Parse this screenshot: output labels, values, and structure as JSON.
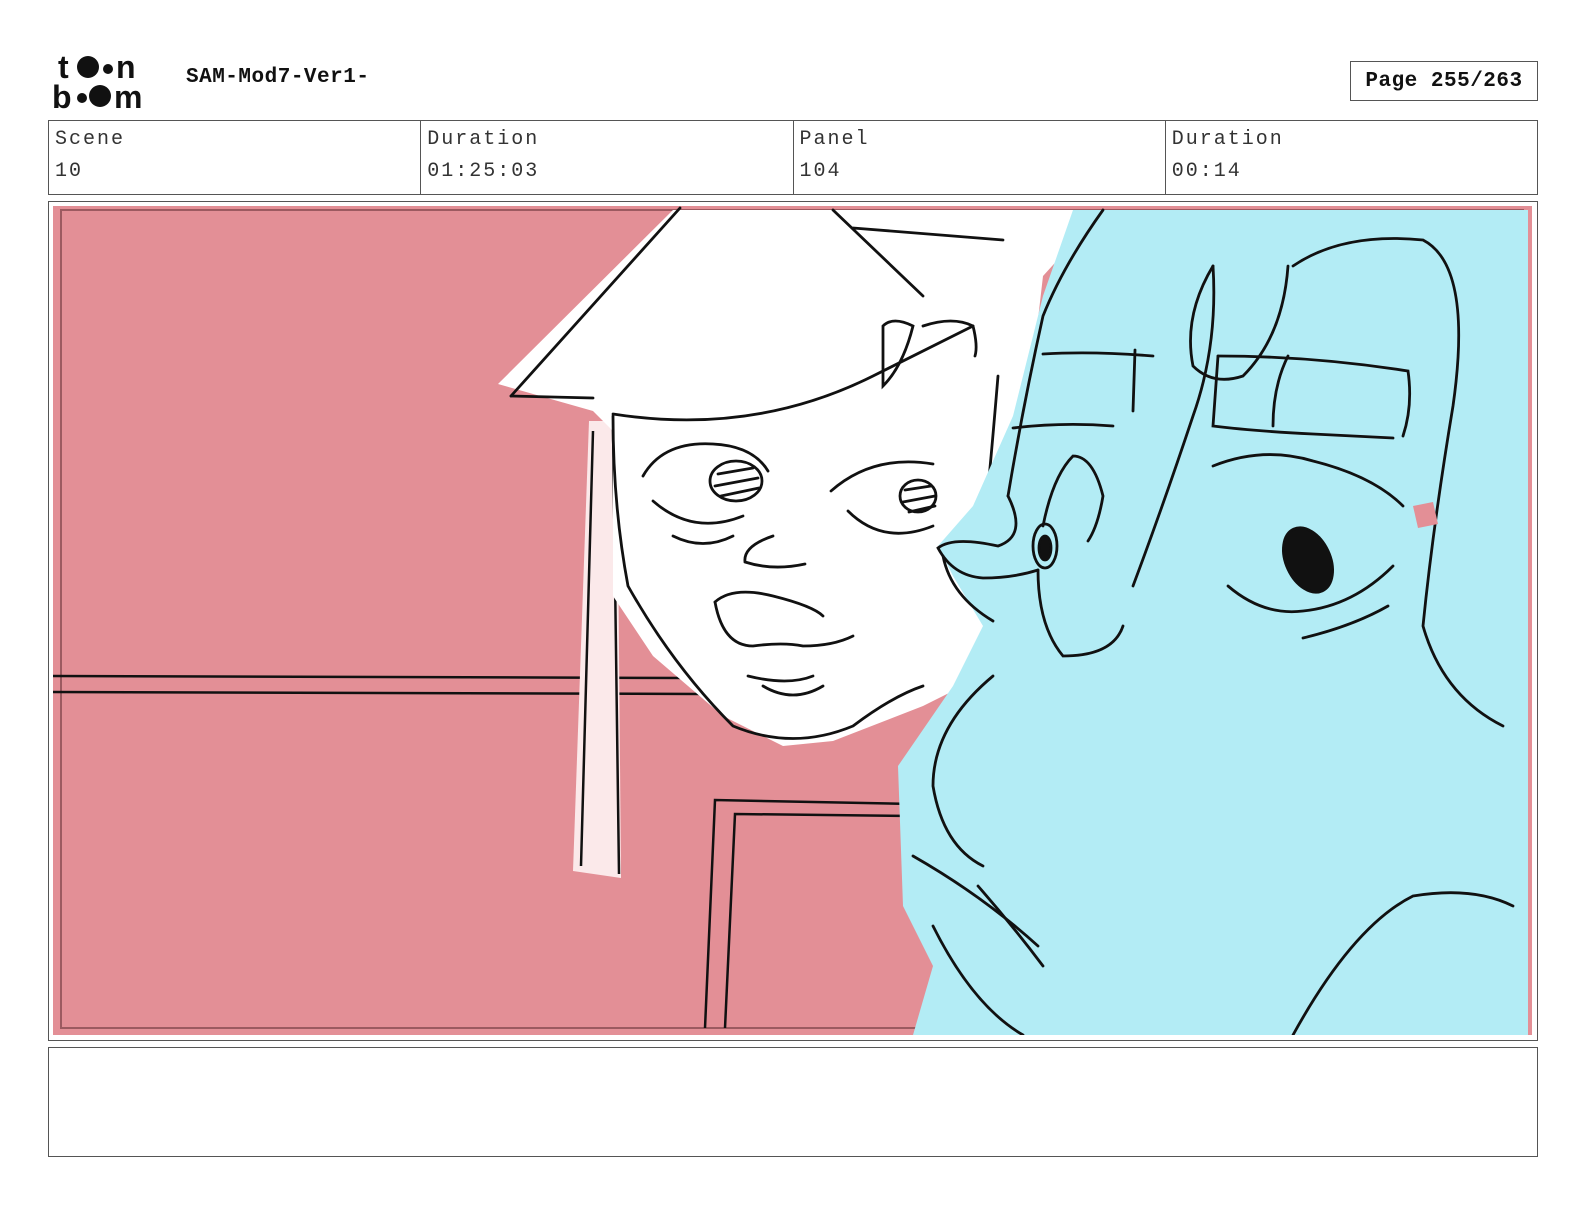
{
  "header": {
    "logo_text": "toon boom",
    "title": "SAM-Mod7-Ver1-",
    "page": "Page 255/263"
  },
  "info": {
    "scene_label": "Scene",
    "scene_value": "10",
    "scene_duration_label": "Duration",
    "scene_duration_value": "01:25:03",
    "panel_label": "Panel",
    "panel_value": "104",
    "panel_duration_label": "Duration",
    "panel_duration_value": "00:14"
  },
  "colors": {
    "background_red": "#e38f96",
    "character_blue": "#b3ecf5",
    "line_black": "#111111"
  },
  "notes": ""
}
